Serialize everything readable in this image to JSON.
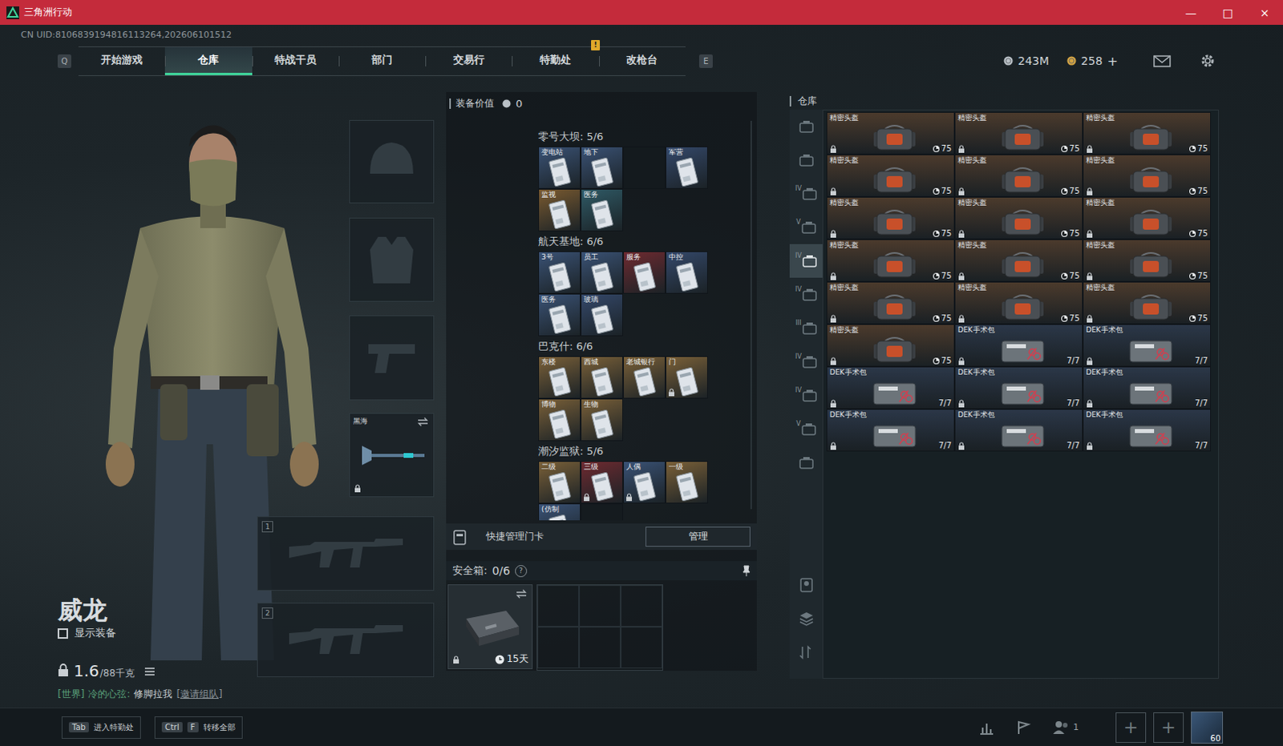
{
  "window": {
    "title": "三角洲行动",
    "controls": [
      "—",
      "□",
      "×"
    ]
  },
  "uid": "CN UID:8106839194816113264,202606101512",
  "nav": {
    "prev_key": "Q",
    "next_key": "E",
    "alert": "!",
    "tabs": [
      {
        "label": "开始游戏",
        "selected": false
      },
      {
        "label": "仓库",
        "selected": true
      },
      {
        "label": "特战干员",
        "selected": false
      },
      {
        "label": "部门",
        "selected": false
      },
      {
        "label": "交易行",
        "selected": false
      },
      {
        "label": "特勤处",
        "selected": false
      },
      {
        "label": "改枪台",
        "selected": false
      }
    ]
  },
  "currency": [
    {
      "amount": "243M",
      "kind": "silver"
    },
    {
      "amount": "258",
      "kind": "gold"
    }
  ],
  "currency_add": "+",
  "operator": {
    "name": "威龙",
    "show_gear": {
      "label": "显示装备",
      "checked": false
    },
    "weight": "1.6",
    "capacity": "/88千克"
  },
  "chat": {
    "channel": "[世界]",
    "sender": "冷的心弦:",
    "message": "修脚拉我",
    "action": "[邀请组队]"
  },
  "equipment": {
    "melee": {
      "name": "黑海",
      "locked": true
    },
    "weapon_slots": [
      "1",
      "2"
    ]
  },
  "loadout_value": {
    "label": "装备价值",
    "value": "0"
  },
  "keycards": [
    {
      "map": "零号大坝:",
      "count": "5/6",
      "slots": [
        {
          "label": "变电站",
          "color": "#3a5275"
        },
        {
          "label": "地下",
          "color": "#3a5275"
        },
        {
          "empty": true
        },
        {
          "label": "军营",
          "color": "#34486a"
        },
        {
          "label": "监视",
          "color": "#7a5a30"
        },
        {
          "label": "医务",
          "color": "#2f5a66"
        }
      ]
    },
    {
      "map": "航天基地:",
      "count": "6/6",
      "slots": [
        {
          "label": "3号",
          "color": "#3a5275"
        },
        {
          "label": "员工",
          "color": "#3a5275"
        },
        {
          "label": "服务",
          "color": "#6e2a30"
        },
        {
          "label": "中控",
          "color": "#34486a"
        },
        {
          "label": "医务",
          "color": "#3a5275"
        },
        {
          "label": "玻璃",
          "color": "#34486a"
        }
      ]
    },
    {
      "map": "巴克什:",
      "count": "6/6",
      "slots": [
        {
          "label": "东楼",
          "color": "#7a6038"
        },
        {
          "label": "西城",
          "color": "#7a6038"
        },
        {
          "label": "老城银行",
          "color": "#7a6038"
        },
        {
          "label": "门",
          "color": "#7a6038",
          "locked": true
        },
        {
          "label": "博物",
          "color": "#7a6038"
        },
        {
          "label": "生物",
          "color": "#7a6038"
        }
      ]
    },
    {
      "map": "潮汐监狱:",
      "count": "5/6",
      "slots": [
        {
          "label": "二级",
          "color": "#7a6038"
        },
        {
          "label": "三级",
          "color": "#6e2a30",
          "locked": true
        },
        {
          "label": "人偶",
          "color": "#3a5275",
          "locked": true
        },
        {
          "label": "一级",
          "color": "#7a6038"
        },
        {
          "label": "(仿制",
          "color": "#3a5275"
        },
        {
          "empty": true
        }
      ]
    }
  ],
  "quick_manage": {
    "label": "快捷管理门卡",
    "button": "管理"
  },
  "safe_box": {
    "label": "安全箱:",
    "count": "0/6",
    "help": "?",
    "duration": "15天",
    "locked": true
  },
  "warehouse": {
    "title": "仓库",
    "side_tabs": [
      {
        "selected": false
      },
      {
        "selected": false
      },
      {
        "label": "IV",
        "selected": false
      },
      {
        "label": "V",
        "selected": false
      },
      {
        "label": "IV",
        "selected": true
      },
      {
        "label": "IV",
        "selected": false
      },
      {
        "label": "III",
        "selected": false
      },
      {
        "label": "IV",
        "selected": false
      },
      {
        "label": "IV",
        "selected": false
      },
      {
        "label": "V",
        "selected": false
      },
      {
        "selected": false
      }
    ],
    "items": [
      {
        "name": "精密头盔",
        "value": "75",
        "kind": "helmet",
        "color": "#4b3a2c",
        "locked": true
      },
      {
        "name": "精密头盔",
        "value": "75",
        "kind": "helmet",
        "color": "#4b3a2c",
        "locked": true
      },
      {
        "name": "精密头盔",
        "value": "75",
        "kind": "helmet",
        "color": "#4b3a2c",
        "locked": true
      },
      {
        "name": "精密头盔",
        "value": "75",
        "kind": "helmet",
        "color": "#4b3a2c",
        "locked": true
      },
      {
        "name": "精密头盔",
        "value": "75",
        "kind": "helmet",
        "color": "#4b3a2c",
        "locked": true
      },
      {
        "name": "精密头盔",
        "value": "75",
        "kind": "helmet",
        "color": "#4b3a2c",
        "locked": true
      },
      {
        "name": "精密头盔",
        "value": "75",
        "kind": "helmet",
        "color": "#4b3a2c",
        "locked": true
      },
      {
        "name": "精密头盔",
        "value": "75",
        "kind": "helmet",
        "color": "#4b3a2c",
        "locked": true
      },
      {
        "name": "精密头盔",
        "value": "75",
        "kind": "helmet",
        "color": "#4b3a2c",
        "locked": true
      },
      {
        "name": "精密头盔",
        "value": "75",
        "kind": "helmet",
        "color": "#4b3a2c",
        "locked": true
      },
      {
        "name": "精密头盔",
        "value": "75",
        "kind": "helmet",
        "color": "#4b3a2c",
        "locked": true
      },
      {
        "name": "精密头盔",
        "value": "75",
        "kind": "helmet",
        "color": "#4b3a2c",
        "locked": true
      },
      {
        "name": "精密头盔",
        "value": "75",
        "kind": "helmet",
        "color": "#4b3a2c",
        "locked": true
      },
      {
        "name": "精密头盔",
        "value": "75",
        "kind": "helmet",
        "color": "#4b3a2c",
        "locked": true
      },
      {
        "name": "精密头盔",
        "value": "75",
        "kind": "helmet",
        "color": "#4b3a2c",
        "locked": true
      },
      {
        "name": "精密头盔",
        "value": "75",
        "kind": "helmet",
        "color": "#4b3a2c",
        "locked": true
      },
      {
        "name": "DEK手术包",
        "value": "7/7",
        "kind": "medkit",
        "color": "#2b3748",
        "locked": true
      },
      {
        "name": "DEK手术包",
        "value": "7/7",
        "kind": "medkit",
        "color": "#2b3748",
        "locked": true
      },
      {
        "name": "DEK手术包",
        "value": "7/7",
        "kind": "medkit",
        "color": "#2b3748",
        "locked": true
      },
      {
        "name": "DEK手术包",
        "value": "7/7",
        "kind": "medkit",
        "color": "#2b3748",
        "locked": true
      },
      {
        "name": "DEK手术包",
        "value": "7/7",
        "kind": "medkit",
        "color": "#2b3748",
        "locked": true
      },
      {
        "name": "DEK手术包",
        "value": "7/7",
        "kind": "medkit",
        "color": "#2b3748",
        "locked": true
      },
      {
        "name": "DEK手术包",
        "value": "7/7",
        "kind": "medkit",
        "color": "#2b3748",
        "locked": true
      },
      {
        "name": "DEK手术包",
        "value": "7/7",
        "kind": "medkit",
        "color": "#2b3748",
        "locked": true
      }
    ]
  },
  "bottom_bar": {
    "shortcuts": [
      {
        "keys": [
          "Tab"
        ],
        "label": "进入特勤处"
      },
      {
        "keys": [
          "Ctrl",
          "F"
        ],
        "label": "转移全部"
      }
    ],
    "friends": "1",
    "add_slots": [
      "+",
      "+"
    ],
    "level": "60"
  }
}
